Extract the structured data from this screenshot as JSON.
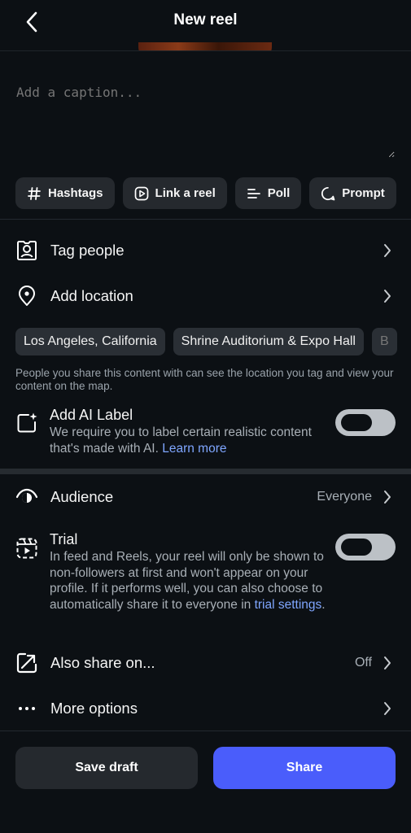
{
  "header": {
    "title": "New reel"
  },
  "caption": {
    "placeholder": "Add a caption..."
  },
  "chips": [
    {
      "label": "Hashtags",
      "icon": "hashtag-icon"
    },
    {
      "label": "Link a reel",
      "icon": "link-reel-icon"
    },
    {
      "label": "Poll",
      "icon": "poll-icon"
    },
    {
      "label": "Prompt",
      "icon": "prompt-icon"
    }
  ],
  "rows": {
    "tag_people": {
      "label": "Tag people"
    },
    "add_location": {
      "label": "Add location"
    },
    "audience": {
      "label": "Audience",
      "value": "Everyone"
    },
    "also_share": {
      "label": "Also share on...",
      "value": "Off"
    },
    "more_options": {
      "label": "More options"
    }
  },
  "location_suggestions": [
    "Los Angeles, California",
    "Shrine Auditorium & Expo Hall",
    "B"
  ],
  "location_note": "People you share this content with can see the location you tag and view your content on the map.",
  "ai_label": {
    "title": "Add AI Label",
    "description": "We require you to label certain realistic content that's made with AI.",
    "link": "Learn more",
    "enabled": false
  },
  "trial": {
    "title": "Trial",
    "description": "In feed and Reels, your reel will only be shown to non-followers at first and won't appear on your profile. If it performs well, you can also choose to automatically share it to everyone in",
    "link": "trial settings",
    "suffix": ".",
    "enabled": false
  },
  "buttons": {
    "save_draft": "Save draft",
    "share": "Share"
  },
  "colors": {
    "background": "#0c1014",
    "accent": "#4a5dfb",
    "link": "#7fa6ff",
    "chip": "#25292e"
  }
}
